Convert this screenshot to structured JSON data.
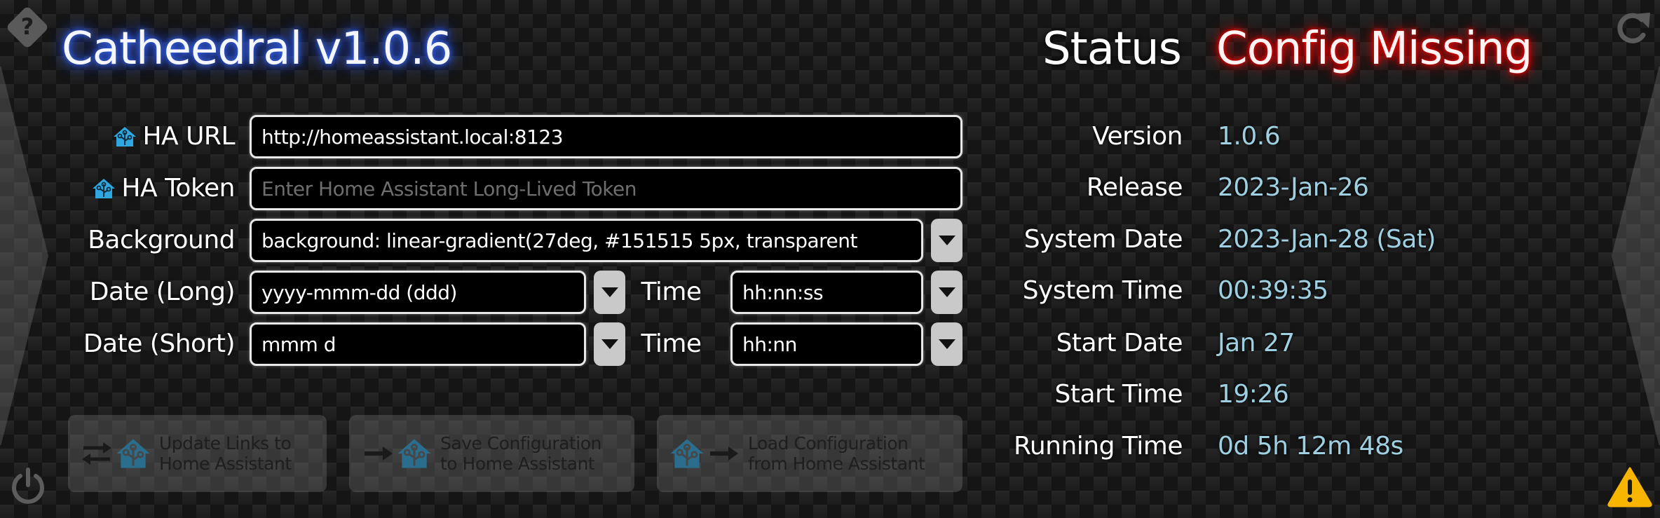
{
  "app": {
    "title": "Catheedral v1.0.6"
  },
  "status": {
    "label": "Status",
    "value": "Config Missing",
    "value_color": "#ff1a1a"
  },
  "icons": {
    "help": "help-icon",
    "power": "power-icon",
    "refresh": "refresh-icon",
    "warning": "warning-icon",
    "home_assistant": "home-assistant-icon"
  },
  "colors": {
    "accent_blue_glow": "#3b6cff",
    "ha_blue": "#2fa7e0",
    "value_text": "#9fd0e2",
    "warning": "#f7b500"
  },
  "form": {
    "ha_url": {
      "label": "HA URL",
      "value": "http://homeassistant.local:8123",
      "placeholder": ""
    },
    "ha_token": {
      "label": "HA Token",
      "value": "",
      "placeholder": "Enter Home Assistant Long-Lived Token"
    },
    "background": {
      "label": "Background",
      "value": "background: linear-gradient(27deg, #151515 5px, transparent"
    },
    "date_long": {
      "label": "Date (Long)",
      "value": "yyyy-mmm-dd (ddd)",
      "time_label": "Time",
      "time_value": "hh:nn:ss"
    },
    "date_short": {
      "label": "Date (Short)",
      "value": "mmm d",
      "time_label": "Time",
      "time_value": "hh:nn"
    }
  },
  "buttons": {
    "update_links": "Update Links to\nHome Assistant",
    "save_config": "Save Configuration\nto Home Assistant",
    "load_config": "Load Configuration\nfrom Home Assistant"
  },
  "info": [
    {
      "label": "Version",
      "value": "1.0.6"
    },
    {
      "label": "Release",
      "value": "2023-Jan-26"
    },
    {
      "label": "System Date",
      "value": "2023-Jan-28 (Sat)"
    },
    {
      "label": "System Time",
      "value": "00:39:35"
    },
    {
      "label": "Start Date",
      "value": "Jan 27"
    },
    {
      "label": "Start Time",
      "value": "19:26"
    },
    {
      "label": "Running Time",
      "value": "0d 5h 12m 48s"
    }
  ]
}
